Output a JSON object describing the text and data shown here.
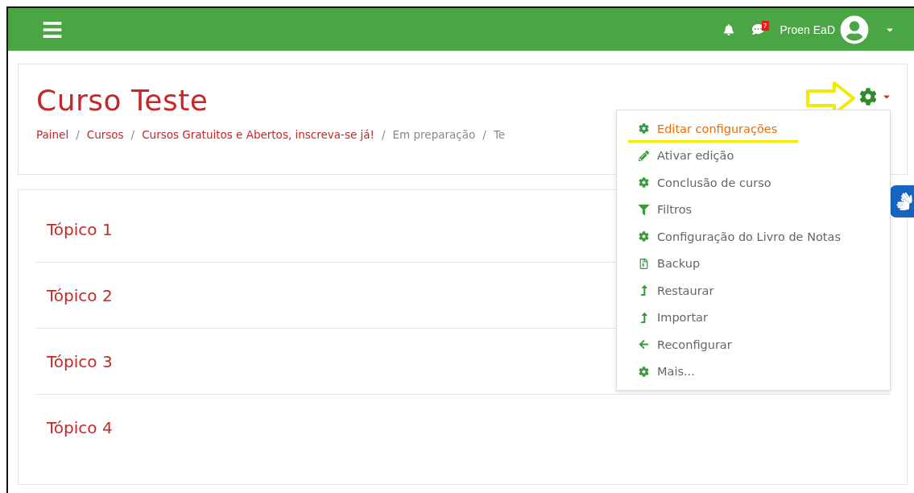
{
  "navbar": {
    "messages_badge": "7",
    "user_name": "Proen EaD"
  },
  "course": {
    "title": "Curso Teste",
    "breadcrumb": [
      {
        "label": "Painel",
        "link": true
      },
      {
        "separator": "/",
        "label": "Cursos",
        "link": true
      },
      {
        "separator": "/",
        "label": "Cursos Gratuitos e Abertos, inscreva-se já!",
        "link": true
      },
      {
        "separator": "/",
        "label": "Em preparação",
        "link": false
      },
      {
        "separator": "/",
        "label": "Te",
        "link": false
      }
    ]
  },
  "settings_menu": {
    "items": [
      {
        "label": "Editar configurações",
        "kind": "gear",
        "selected": true
      },
      {
        "label": "Ativar edição",
        "kind": "pencil",
        "selected": false
      },
      {
        "label": "Conclusão de curso",
        "kind": "gear",
        "selected": false
      },
      {
        "label": "Filtros",
        "kind": "filter",
        "selected": false
      },
      {
        "label": "Configuração do Livro de Notas",
        "kind": "gear",
        "selected": false
      },
      {
        "label": "Backup",
        "kind": "backup",
        "selected": false
      },
      {
        "label": "Restaurar",
        "kind": "upload",
        "selected": false
      },
      {
        "label": "Importar",
        "kind": "upload",
        "selected": false
      },
      {
        "label": "Reconfigurar",
        "kind": "back",
        "selected": false
      },
      {
        "label": "Mais...",
        "kind": "gear",
        "selected": false
      }
    ]
  },
  "topics": [
    {
      "title": "Tópico 1"
    },
    {
      "title": "Tópico 2"
    },
    {
      "title": "Tópico 3"
    },
    {
      "title": "Tópico 4"
    }
  ]
}
